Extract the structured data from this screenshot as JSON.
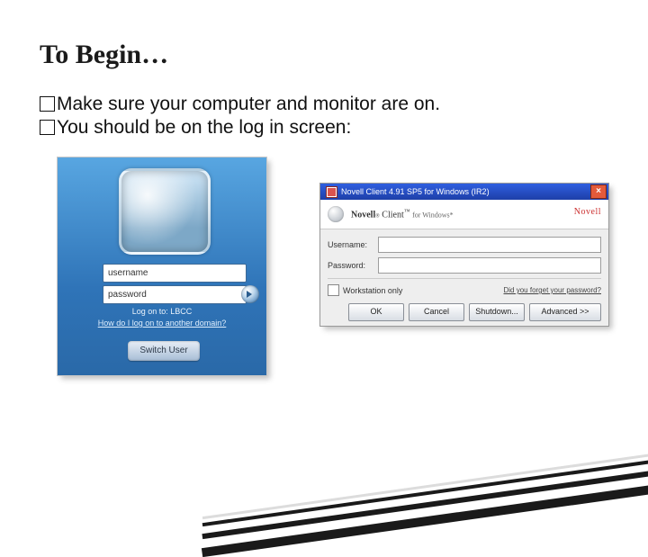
{
  "title": "To Begin…",
  "bullets": [
    "Make sure your computer and monitor are on.",
    "You should be on the log in screen:"
  ],
  "windows_login": {
    "username_placeholder": "username",
    "password_placeholder": "password",
    "logon_text": "Log on to: LBCC",
    "other_domain_text": "How do I log on to another domain?",
    "switch_user": "Switch User"
  },
  "novell": {
    "window_title": "Novell Client 4.91 SP5 for Windows (IR2)",
    "brand": "Novell",
    "brand_suffix": "Client",
    "brand_tm": "™",
    "brand_for": "for Windows*",
    "brand_right": "Novell",
    "labels": {
      "username": "Username:",
      "password": "Password:"
    },
    "workstation_only": "Workstation only",
    "forgot": "Did you forget your password?",
    "buttons": {
      "ok": "OK",
      "cancel": "Cancel",
      "shutdown": "Shutdown...",
      "advanced": "Advanced >>"
    }
  }
}
